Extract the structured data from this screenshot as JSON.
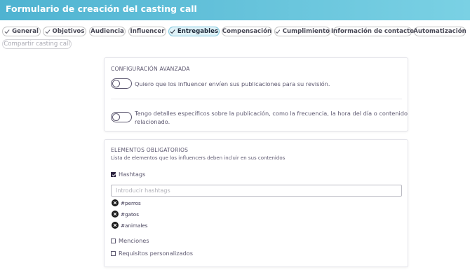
{
  "header": {
    "title": "Formulario de creación del casting call"
  },
  "tabs": [
    {
      "label": "General",
      "checked": true,
      "state": "done"
    },
    {
      "label": "Objetivos",
      "checked": true,
      "state": "done"
    },
    {
      "label": "Audiencia",
      "checked": false,
      "state": "normal"
    },
    {
      "label": "Influencer",
      "checked": false,
      "state": "normal"
    },
    {
      "label": "Entregables",
      "checked": true,
      "state": "active"
    },
    {
      "label": "Compensación",
      "checked": false,
      "state": "normal"
    },
    {
      "label": "Cumplimiento",
      "checked": true,
      "state": "done"
    },
    {
      "label": "Información de contacto",
      "checked": false,
      "state": "normal"
    },
    {
      "label": "Automatización",
      "checked": false,
      "state": "normal"
    },
    {
      "label": "Compartir casting call",
      "checked": false,
      "state": "disabled"
    }
  ],
  "advanced": {
    "title": "CONFIGURACIÓN AVANZADA",
    "toggle1_label": "Quiero que los influencer envíen sus publicaciones para su revisión.",
    "toggle1_on": false,
    "toggle2_label_line1": "Tengo detalles específicos sobre la publicación, como la frecuencia, la hora del día o contenido",
    "toggle2_label_line2": "relacionado.",
    "toggle2_on": false
  },
  "required": {
    "title": "ELEMENTOS OBLIGATORIOS",
    "subtitle": "Lista de elementos que los influencers deben incluir en sus contenidos",
    "hashtags_label": "Hashtags",
    "hashtags_checked": true,
    "hashtags_placeholder": "Introducir hashtags",
    "hashtags": [
      "#perros",
      "#gatos",
      "#animales"
    ],
    "mentions_label": "Menciones",
    "mentions_checked": false,
    "custom_label": "Requisitos personalizados",
    "custom_checked": false
  },
  "colors": {
    "header_gradient_start": "#4fb3d1",
    "header_gradient_end": "#7ad1e4",
    "active_tab_bg": "#dff2f8",
    "text_primary": "#3a3550",
    "checkbox_checked": "#2d2440"
  },
  "icons": {
    "tab_done": "check-icon",
    "chip_remove": "close-circle-icon"
  }
}
